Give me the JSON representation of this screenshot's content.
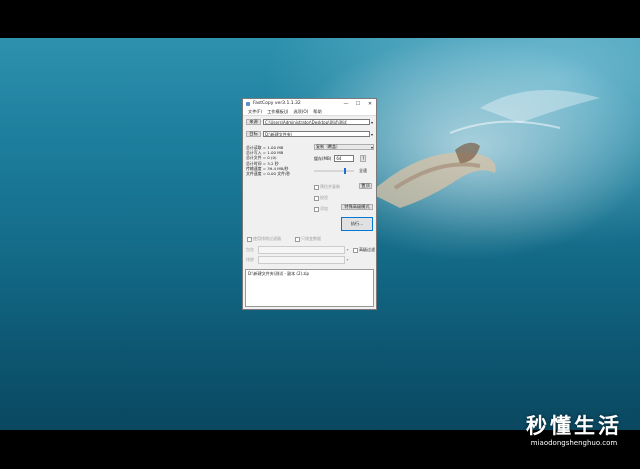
{
  "window": {
    "title": "FastCopy ver3.1.1.32",
    "controls": {
      "minimize": "—",
      "maximize": "☐",
      "close": "✕"
    }
  },
  "menu": [
    "文件(F)",
    "工作模板(J)",
    "选项(O)",
    "帮助"
  ],
  "source": {
    "button_label": "来源",
    "path": "C:\\Users\\Administrator\\Desktop\\测试\\测试"
  },
  "target": {
    "button_label": "目标",
    "path": "D:\\新建文件夹\\"
  },
  "stats": [
    "总计读取 = 1.00 MB",
    "总计写入 = 1.00 MB",
    "总计文件 = 0 (0)",
    "总计时间 = 3.2 秒",
    "传输速度 = 39.4 MB/秒",
    "文件速度 = 0.00 文件/秒"
  ],
  "mode": {
    "selected": "复制（覆盖）"
  },
  "buffer": {
    "label": "缓存(MB)",
    "value": "64"
  },
  "speed": {
    "label": "全速"
  },
  "options": {
    "estimate": "预估并复制",
    "verify": "校验",
    "acl": "添加",
    "top_button": "置顶",
    "advanced_button": "特殊高级模式",
    "execute_button": "执行..."
  },
  "filters": {
    "sub_checkbox_1": "使用排除过滤器",
    "sub_checkbox_2": "只改变数据",
    "include_label": "包含",
    "exclude_label": "排除",
    "filter_checkbox": "高级过滤"
  },
  "log": "D:\\新建文件夹\\测试 - 副本 (2).zip",
  "watermark": {
    "main": "秒懂生活",
    "url": "miaodongshenghuo.com"
  }
}
